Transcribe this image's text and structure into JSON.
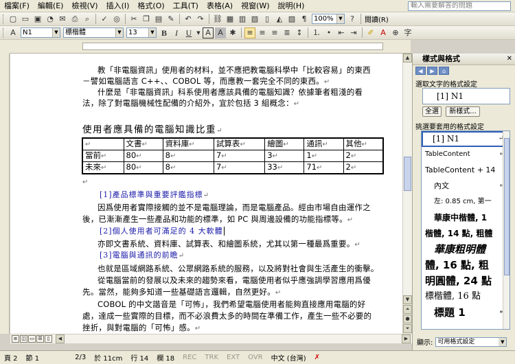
{
  "menu": {
    "items": [
      "檔案(F)",
      "編輯(E)",
      "檢視(V)",
      "插入(I)",
      "格式(O)",
      "工具(T)",
      "表格(A)",
      "視窗(W)",
      "說明(H)"
    ],
    "help_placeholder": "輸入需要解答的問題"
  },
  "toolbar1": {
    "zoom": "100%",
    "read_label": "閱讀(R)"
  },
  "toolbar2": {
    "style": "N1",
    "font": "標楷體",
    "size": "13"
  },
  "document": {
    "lines": [
      "教「非電腦資訊」使用者的材料，並不應把教電腦科學中「比較容易」的東西",
      "－譬如電腦語言 C++、、COBOL 等，而應教一套完全不同的東西。",
      "什麼是「非電腦資訊」科系使用者應該具備的電腦知識？依據筆者粗淺的看",
      "法，除了對電腦機械性配備的介紹外，宜於包括 3 組概念："
    ],
    "table_title": "使用者應具備的電腦知識比重",
    "table": {
      "header": [
        "",
        "文書",
        "資料庫",
        "試算表",
        "繪圖",
        "通訊",
        "其他"
      ],
      "rows": [
        [
          "當前",
          "80",
          "8",
          "7",
          "3",
          "1",
          "2"
        ],
        [
          "未來",
          "80",
          "8",
          "7",
          "33",
          "71",
          "2"
        ]
      ]
    },
    "section1_head": "[1]產品標準與重要評鑑指標",
    "section1_lines": [
      "因爲使用者實際接觸的並不是電腦理論，而是電腦產品。經由市場自由運作之",
      "後，已漸漸產生一些產品和功能的標準，如 PC 與周邊設備的功能指標等。"
    ],
    "section2_head": "[2]個人使用者可滿足的 4 大軟體",
    "section2_lines": [
      "亦即文書系統、資料庫、試算表、和繪圖系統，尤其以第一種最爲重要。"
    ],
    "section3_head": "[3]電腦與通訊的前瞻",
    "section3_lines": [
      "也就是區域網路系統、公眾網路系統的服務，以及將對社會與生活產生的衝擊。",
      "從電腦當前的發展以及未來的趨勢來看，電腦使用者似乎應強調學習應用爲優",
      "先。當然，能夠多知道一些基礎語言邏輯，自然更好。",
      "COBOL 的中文諧音是「可怖」，我們希望電腦使用者能夠直接應用電腦的好",
      "處，達成一些實際的目標，而不必浪費太多的時間在準備工作，產生一些不必要的",
      "挫折，與對電腦的「可怖」感。"
    ],
    "pilcrow": "↵"
  },
  "task_pane": {
    "title": "樣式與格式",
    "selected_label": "選取文字的格式設定",
    "selected_style": "[1]  N1",
    "select_all": "全選",
    "new_style": "新樣式...",
    "apply_label": "挑選要套用的格式設定",
    "styles": [
      "[1]  N1",
      "TableContent",
      "TableContent + 14",
      "內文",
      "左: 0.85 cm, 第一",
      "華康中楷體, 1",
      "楷體, 14 點, 粗體",
      "華康粗明體",
      "體, 16 點, 粗",
      "明圓體, 24 點",
      "標楷體, 16 點",
      "標題 1"
    ],
    "show_label": "顯示:",
    "show_value": "可用格式設定"
  },
  "status": {
    "page": "頁 2",
    "section": "節 1",
    "pages": "2/3",
    "at": "於 11cm",
    "line": "行 14",
    "col": "欄 18",
    "rec": "REC",
    "trk": "TRK",
    "ext": "EXT",
    "ovr": "OVR",
    "lang": "中文 (台灣)"
  }
}
